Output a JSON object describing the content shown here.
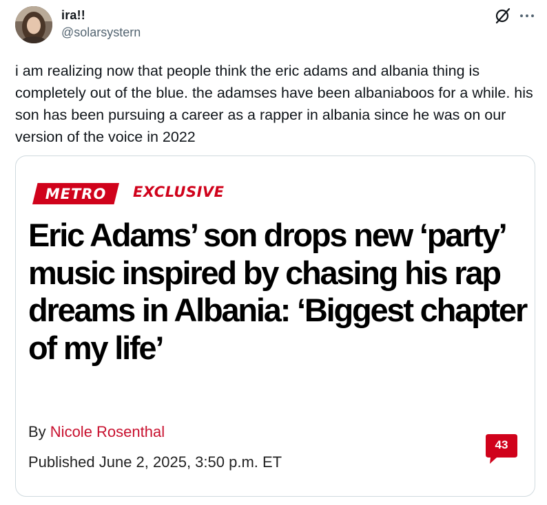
{
  "tweet": {
    "author": {
      "display_name": "ira!!",
      "handle": "@solarsystern"
    },
    "icons": {
      "grok": "grok-icon",
      "more": "more-options-icon"
    },
    "text": "i am realizing now that people think the eric adams and albania thing is completely out of the blue. the adamses have been albaniaboos for a while. his son has been pursuing a career as a rapper in albania since he was on our version of the voice in 2022"
  },
  "card": {
    "section_label": "METRO",
    "exclusive_label": "EXCLUSIVE",
    "headline": "Eric Adams’ son drops new ‘party’ music inspired by chasing his rap dreams in Albania: ‘Biggest chapter of my life’",
    "byline_prefix": "By ",
    "author": "Nicole Rosenthal",
    "published": "Published June 2, 2025, 3:50 p.m. ET",
    "comment_count": "43"
  },
  "colors": {
    "brand_red": "#d0021b",
    "author_red": "#c8102e",
    "handle_gray": "#536471",
    "border": "#cfd9de"
  }
}
